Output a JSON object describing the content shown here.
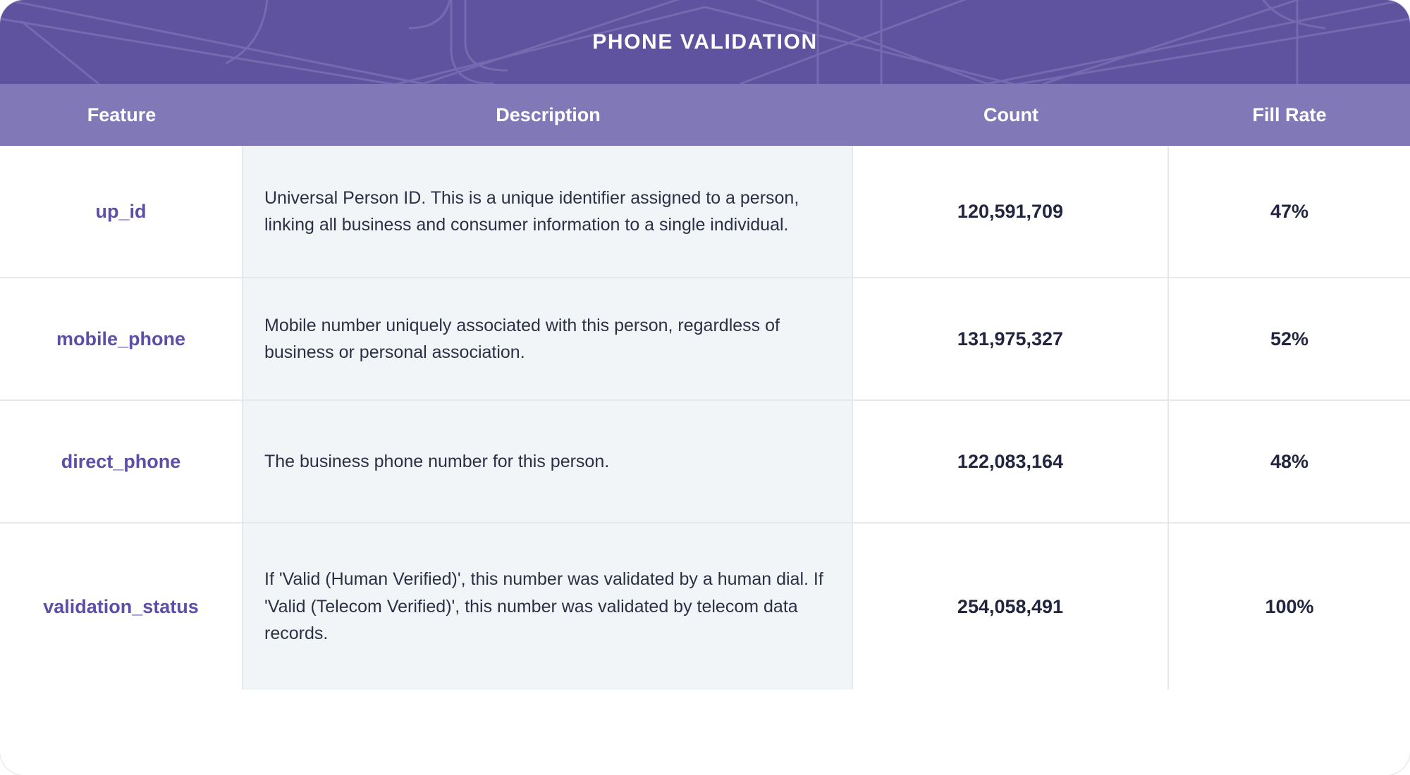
{
  "header": {
    "title": "PHONE VALIDATION",
    "banner_color": "#5f53a0",
    "columns_bar_color": "#8178b8"
  },
  "table": {
    "columns": [
      {
        "key": "feature",
        "label": "Feature"
      },
      {
        "key": "description",
        "label": "Description"
      },
      {
        "key": "count",
        "label": "Count"
      },
      {
        "key": "fill_rate",
        "label": "Fill Rate"
      }
    ],
    "rows": [
      {
        "feature": "up_id",
        "description": "Universal Person ID. This is a unique identifier assigned to a person, linking all business and consumer information to a single individual.",
        "count": "120,591,709",
        "fill_rate": "47%"
      },
      {
        "feature": "mobile_phone",
        "description": "Mobile number uniquely associated with this person, regardless of business or personal association.",
        "count": "131,975,327",
        "fill_rate": "52%"
      },
      {
        "feature": "direct_phone",
        "description": "The business phone number for this person.",
        "count": "122,083,164",
        "fill_rate": "48%"
      },
      {
        "feature": "validation_status",
        "description": "If 'Valid (Human Verified)', this number was validated by a human dial. If 'Valid (Telecom Verified)', this number was validated by telecom data records.",
        "count": "254,058,491",
        "fill_rate": "100%"
      }
    ]
  },
  "colors": {
    "feature_text": "#5b4fa8",
    "value_text": "#212540",
    "description_bg": "#f1f5f8",
    "grid_line": "#e4e8ef"
  }
}
